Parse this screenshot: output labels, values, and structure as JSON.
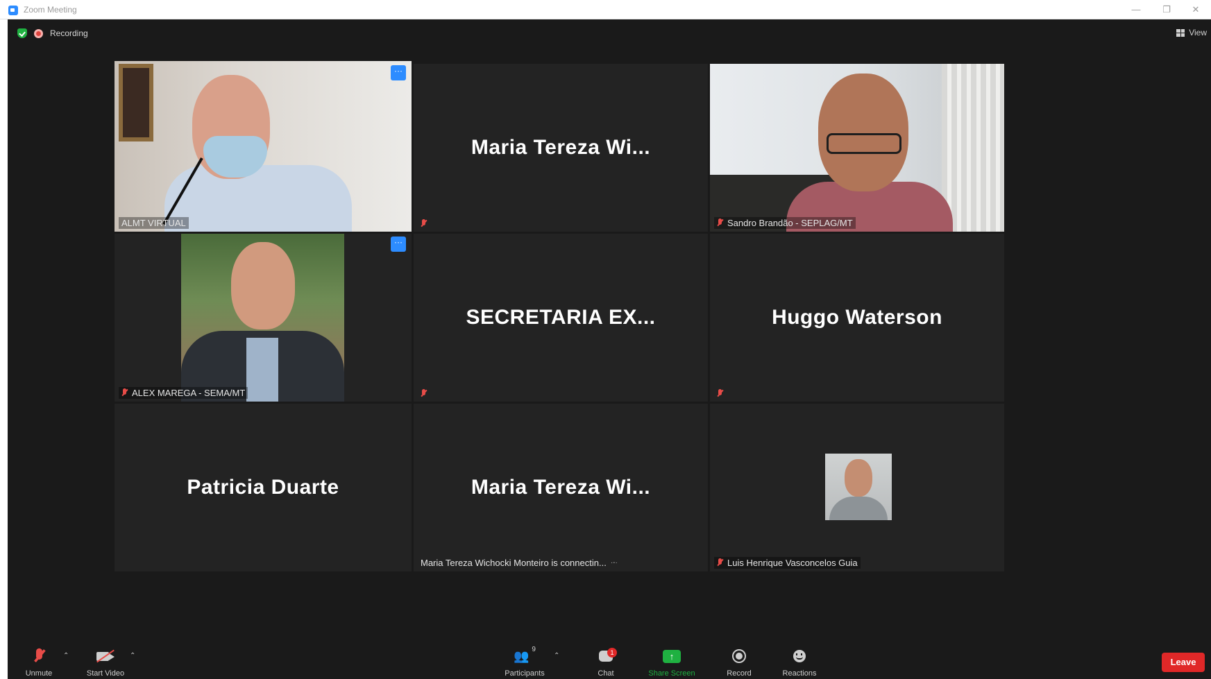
{
  "window": {
    "title": "Zoom Meeting"
  },
  "topbar": {
    "recording_label": "Recording",
    "view_label": "View"
  },
  "tiles": [
    {
      "name_label": "ALMT VIRTUAL",
      "type": "video"
    },
    {
      "display_name": "Maria Tereza Wi...",
      "type": "name"
    },
    {
      "name_label": "Sandro Brandão - SEPLAG/MT",
      "type": "video"
    },
    {
      "name_label": "ALEX MAREGA - SEMA/MT",
      "type": "photo"
    },
    {
      "display_name": "SECRETARIA EX...",
      "type": "name"
    },
    {
      "display_name": "Huggo Waterson",
      "type": "name"
    },
    {
      "display_name": "Patricia Duarte",
      "type": "name"
    },
    {
      "display_name": "Maria Tereza Wi...",
      "status_label": "Maria Tereza Wichocki Monteiro is connectin...",
      "type": "name"
    },
    {
      "name_label": "Luis Henrique Vasconcelos Guia",
      "type": "photo"
    }
  ],
  "toolbar": {
    "unmute_label": "Unmute",
    "start_video_label": "Start Video",
    "participants_label": "Participants",
    "participants_count": "9",
    "chat_label": "Chat",
    "chat_badge": "1",
    "share_screen_label": "Share Screen",
    "record_label": "Record",
    "reactions_label": "Reactions",
    "leave_label": "Leave"
  },
  "colors": {
    "active_speaker": "#c7e23b",
    "share_green": "#1fb141",
    "leave_red": "#e02828",
    "accent_blue": "#2d8cff"
  }
}
